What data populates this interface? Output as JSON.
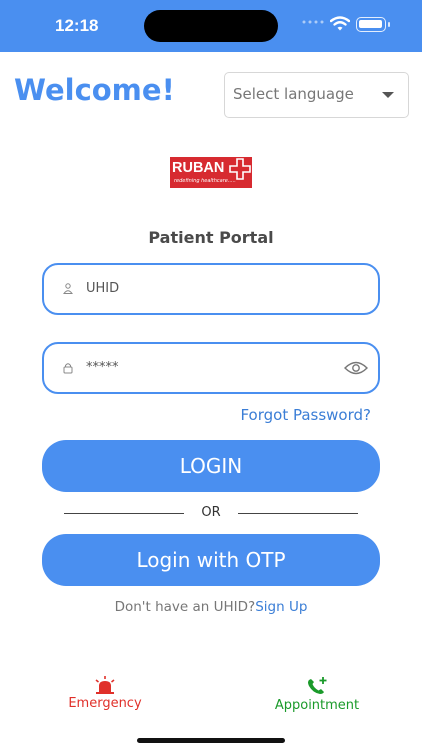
{
  "status_bar": {
    "time": "12:18"
  },
  "header": {
    "welcome": "Welcome!",
    "language_placeholder": "Select language"
  },
  "logo": {
    "name": "RUBAN",
    "tagline": "redefining healthcare....."
  },
  "portal": {
    "title": "Patient Portal"
  },
  "form": {
    "uhid_value": "UHID",
    "password_value": "*****",
    "forgot_label": "Forgot Password?",
    "login_label": "LOGIN",
    "or_label": "OR",
    "otp_label": "Login with OTP",
    "signup_prompt": "Don't have an UHID?",
    "signup_link": "Sign Up"
  },
  "bottom_nav": {
    "emergency": "Emergency",
    "appointment": "Appointment"
  },
  "colors": {
    "primary": "#4a8ff0",
    "emergency": "#e0302a",
    "appointment": "#1a9a2a",
    "brand": "#d72a30"
  },
  "icons": [
    "wifi-icon",
    "battery-icon",
    "chevron-down-icon",
    "user-icon",
    "lock-icon",
    "eye-icon",
    "siren-icon",
    "phone-plus-icon"
  ]
}
